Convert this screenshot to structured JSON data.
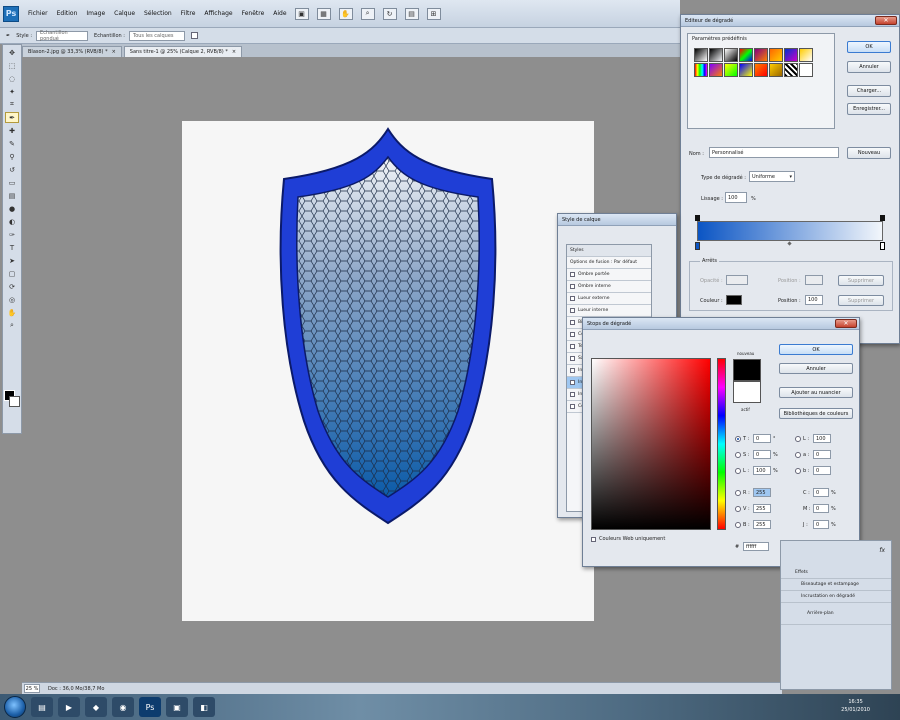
{
  "menubar": {
    "logo": "Ps",
    "items": [
      "Fichier",
      "Edition",
      "Image",
      "Calque",
      "Sélection",
      "Filtre",
      "Affichage",
      "Fenêtre",
      "Aide"
    ]
  },
  "options": {
    "style_label": "Style :",
    "style_value": "Echantillon pondué",
    "echantillon_label": "Echantillon :",
    "echantillon_value": "Tous les calques"
  },
  "tabs": [
    {
      "label": "Blason-2.jpg @ 33,3% (RVB/8) *"
    },
    {
      "label": "Sans titre-1 @ 25% (Calque 2, RVB/8) *"
    }
  ],
  "status": {
    "zoom": "25 %",
    "doc": "Doc : 36,0 Mo/38,7 Mo"
  },
  "gradient_editor": {
    "title": "Editeur de dégradé",
    "presets_label": "Paramètres prédéfinis",
    "ok": "OK",
    "cancel": "Annuler",
    "load": "Charger...",
    "save": "Enregistrer...",
    "name_label": "Nom :",
    "name_value": "Personnalisé",
    "new_btn": "Nouveau",
    "type_label": "Type de dégradé :",
    "type_value": "Uniforme",
    "smooth_label": "Lissage :",
    "smooth_value": "100",
    "pct": "%",
    "stops_label": "Arrêts",
    "opacity_label": "Opacité :",
    "pos_label": "Position :",
    "delete_label": "Supprimer",
    "color_label": "Couleur :",
    "pos_value": "100",
    "gradient_colors": {
      "start": "#0b55c4",
      "end": "#f2f6fb"
    },
    "swatches": [
      "#000000",
      "#808080",
      "#ffffff",
      "#ff0000",
      "#ff8000",
      "#ff6600",
      "#cc00cc",
      "#ffcc00",
      "#ff0000",
      "#8000ff",
      "#00ff00",
      "#0000ff",
      "#ffff00",
      "#00ffff",
      "#ff00ff",
      "#999999"
    ]
  },
  "layer_style": {
    "title": "Style de calque",
    "styles_header": "Styles",
    "blend_options": "Options de fusion : Par défaut",
    "items": [
      "Ombre portée",
      "Ombre interne",
      "Lueur externe",
      "Lueur interne",
      "Biseautage et estampage",
      "Contour",
      "Texture",
      "Satin",
      "Incrustation couleur",
      "Incrustation en dégradé",
      "Incrustation de motif",
      "Contour"
    ]
  },
  "color_picker": {
    "title": "Stops de dégradé",
    "ok": "OK",
    "cancel": "Annuler",
    "add_swatch": "Ajouter au nuancier",
    "libraries": "Bibliothèques de couleurs",
    "new_label": "nouveau",
    "current_label": "actif",
    "web_only": "Couleurs Web uniquement",
    "hsb": [
      {
        "label": "T :",
        "value": "0",
        "unit": "°"
      },
      {
        "label": "S :",
        "value": "0",
        "unit": "%"
      },
      {
        "label": "L :",
        "value": "100",
        "unit": "%"
      }
    ],
    "rgb": [
      {
        "label": "R :",
        "value": "255"
      },
      {
        "label": "V :",
        "value": "255"
      },
      {
        "label": "B :",
        "value": "255"
      }
    ],
    "lab": [
      {
        "label": "L :",
        "value": "100"
      },
      {
        "label": "a :",
        "value": "0"
      },
      {
        "label": "b :",
        "value": "0"
      }
    ],
    "cmyk": [
      {
        "label": "C :",
        "value": "0",
        "unit": "%"
      },
      {
        "label": "M :",
        "value": "0",
        "unit": "%"
      },
      {
        "label": "J :",
        "value": "0",
        "unit": "%"
      },
      {
        "label": "N :",
        "value": "0",
        "unit": "%"
      }
    ],
    "hex_label": "#",
    "hex_value": "ffffff",
    "hue_color": "#ff0000"
  },
  "layers_panel": {
    "items": [
      "Effets",
      "Biseautage et estampage",
      "Incrustation en dégradé",
      "Arrière-plan"
    ],
    "fx": "fx"
  },
  "taskbar": {
    "time": "16:35",
    "date": "25/01/2010"
  }
}
